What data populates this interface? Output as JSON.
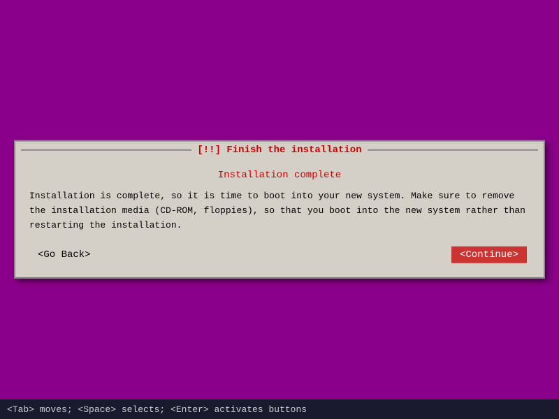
{
  "background": {
    "color": "#8B008B"
  },
  "dialog": {
    "title": "[!!] Finish the installation",
    "subtitle": "Installation complete",
    "message": "Installation is complete, so it is time to boot into your new system. Make sure to remove\nthe installation media (CD-ROM, floppies), so that you boot into the new system rather\nthan restarting the installation.",
    "go_back_label": "<Go Back>",
    "continue_label": "<Continue>"
  },
  "bottom_bar": {
    "text": "<Tab> moves; <Space> selects; <Enter> activates buttons"
  }
}
